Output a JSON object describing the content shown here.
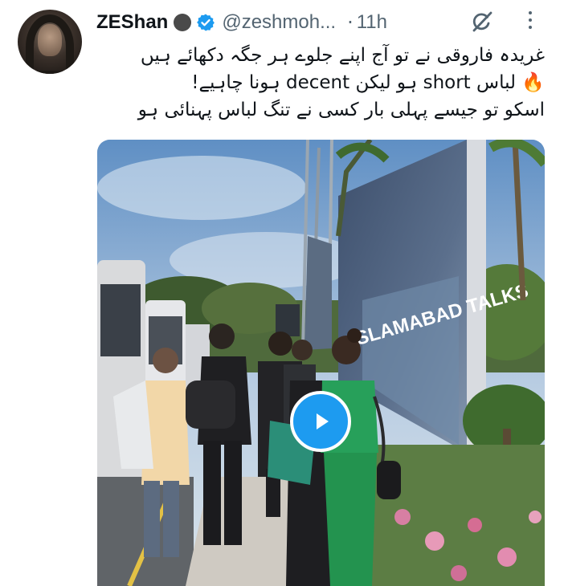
{
  "tweet": {
    "author_name": "ZEShan",
    "handle": "@zeshmoh...",
    "separator": "·",
    "time": "11h",
    "text_lines": [
      "غریدہ فاروقی نے تو آج اپنے جلوے ہر جگہ دکھائے ہیں",
      "🔥 لباس short ہو لیکن decent ہونا چاہیے!",
      "اسکو تو جیسے پہلی بار کسی نے تنگ لباس پہنائی ہو"
    ]
  },
  "icons": {
    "badge": "circle-badge-icon",
    "verified": "verified-check-icon",
    "grok": "grok-icon",
    "more": "more-options-icon",
    "play": "play-icon"
  },
  "colors": {
    "accent": "#1d9bf0",
    "muted": "#536471",
    "text": "#0f1419",
    "dress_green": "#27a05a"
  },
  "media": {
    "type": "video",
    "billboard_text": "ISLAMABAD TALKS"
  }
}
